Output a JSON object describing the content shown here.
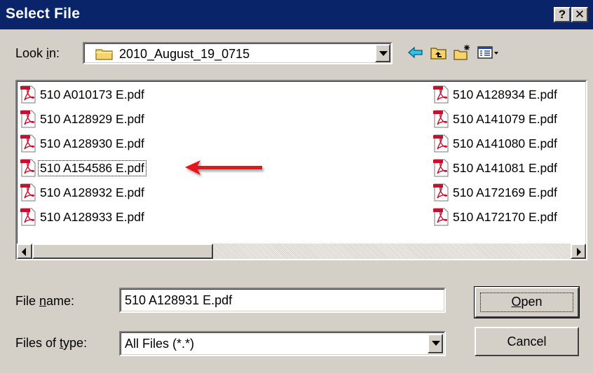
{
  "window": {
    "title": "Select File",
    "help_glyph": "?",
    "close_glyph": "✕"
  },
  "look_in": {
    "label_pre": "Look ",
    "label_accel": "i",
    "label_post": "n:",
    "value": "2010_August_19_0715",
    "icon": "folder-icon"
  },
  "toolbar": {
    "icons": [
      "back-arrow-icon",
      "up-folder-icon",
      "new-folder-icon",
      "view-menu-icon"
    ]
  },
  "file_list": {
    "column_left": [
      "510 A010173 E.pdf",
      "510 A128929 E.pdf",
      "510 A128930 E.pdf",
      "510 A154586 E.pdf",
      "510 A128932 E.pdf",
      "510 A128933 E.pdf"
    ],
    "column_right": [
      "510 A128934 E.pdf",
      "510 A141079 E.pdf",
      "510 A141080 E.pdf",
      "510 A141081 E.pdf",
      "510 A172169 E.pdf",
      "510 A172170 E.pdf"
    ],
    "focused_item": "510 A154586 E.pdf",
    "annotation": "red-arrow-pointing-left",
    "annotation_color": "#e8141b"
  },
  "file_name": {
    "label_pre": "File ",
    "label_accel": "n",
    "label_post": "ame:",
    "value": "510 A128931 E.pdf"
  },
  "file_type": {
    "label_pre": "Files of ",
    "label_accel": "t",
    "label_post": "ype:",
    "value": "All Files (*.*)"
  },
  "buttons": {
    "open_accel": "O",
    "open_rest": "pen",
    "cancel": "Cancel"
  },
  "colors": {
    "titlebar": "#0a246a",
    "dialog_face": "#d4d0c8",
    "pdf_icon_red": "#c8102e"
  }
}
